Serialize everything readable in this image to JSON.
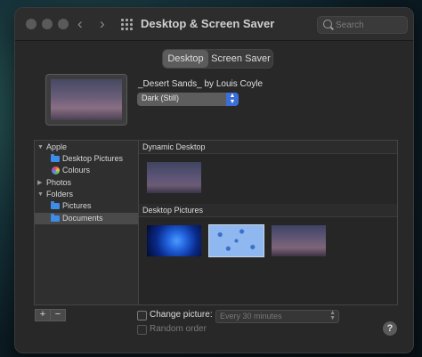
{
  "window": {
    "title": "Desktop & Screen Saver"
  },
  "search": {
    "placeholder": "Search"
  },
  "tabs": [
    {
      "label": "Desktop",
      "active": true
    },
    {
      "label": "Screen Saver",
      "active": false
    }
  ],
  "wallpaper": {
    "name": "_Desert Sands_ by Louis Coyle",
    "mode": "Dark (Still)"
  },
  "sidebar": {
    "groups": [
      {
        "label": "Apple",
        "items": [
          {
            "label": "Desktop Pictures",
            "icon": "folder-icon"
          },
          {
            "label": "Colours",
            "icon": "colours-icon"
          }
        ]
      },
      {
        "label": "Photos"
      },
      {
        "label": "Folders",
        "items": [
          {
            "label": "Pictures",
            "icon": "folder-icon"
          },
          {
            "label": "Documents",
            "icon": "folder-icon",
            "selected": true
          }
        ]
      }
    ],
    "add_label": "+",
    "remove_label": "−"
  },
  "sections": {
    "dynamic": {
      "title": "Dynamic Desktop"
    },
    "pictures": {
      "title": "Desktop Pictures"
    }
  },
  "options": {
    "change_picture": {
      "label": "Change picture:",
      "checked": false
    },
    "interval": {
      "value": "Every 30 minutes"
    },
    "random_order": {
      "label": "Random order",
      "checked": false,
      "disabled": true
    },
    "help_label": "?"
  },
  "colors": {
    "accent": "#3a6fd8",
    "folder": "#3d8ce8"
  }
}
